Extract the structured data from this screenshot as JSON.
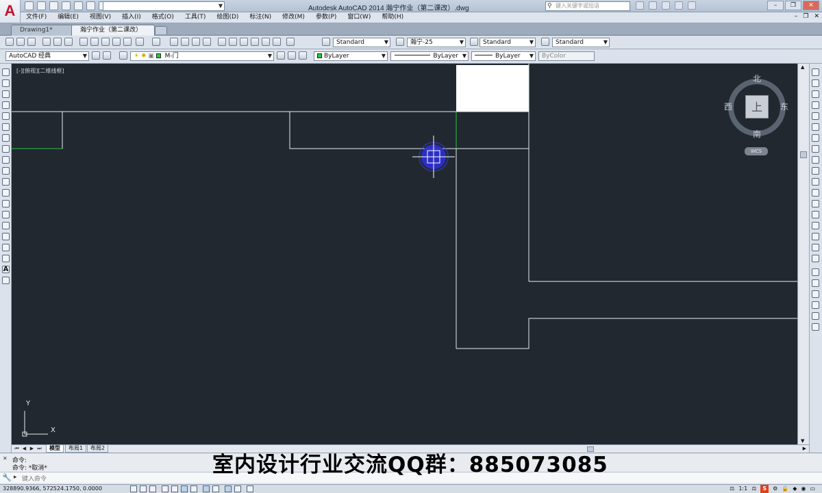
{
  "app": {
    "logo": "A",
    "title": "Autodesk AutoCAD 2014    瀚宁作业（第二课改）.dwg",
    "search_placeholder": "键入关键字或短语",
    "workspace_quick": ""
  },
  "menu": [
    "文件(F)",
    "编辑(E)",
    "视图(V)",
    "插入(I)",
    "格式(O)",
    "工具(T)",
    "绘图(D)",
    "标注(N)",
    "修改(M)",
    "参数(P)",
    "窗口(W)",
    "帮助(H)"
  ],
  "tabs": {
    "drawing1": "Drawing1*",
    "current": "瀚宁作业（第二课改）*"
  },
  "toolbar1": {
    "text_style": "Standard",
    "dim_style": "瀚宁-25",
    "table_style": "Standard",
    "mleader_style": "Standard"
  },
  "toolbar2": {
    "workspace": "AutoCAD 经典",
    "layer": "M-门",
    "color": "ByLayer",
    "linetype": "ByLayer",
    "lineweight": "ByLayer",
    "plotstyle": "ByColor"
  },
  "viewport": {
    "label": "[-][俯视][二维线框]"
  },
  "viewcube": {
    "north": "北",
    "south": "南",
    "east": "东",
    "west": "西",
    "top": "上",
    "wcs": "WCS"
  },
  "ucs": {
    "x": "X",
    "y": "Y"
  },
  "layout_tabs": [
    "模型",
    "布局1",
    "布局2"
  ],
  "command": {
    "line1": "命令:",
    "line2": "命令: *取消*",
    "input_placeholder": "键入命令"
  },
  "status": {
    "coords": "328890.9366, 572524.1750, 0.0000",
    "scale": "1:1",
    "app_s": "S"
  },
  "overlay": {
    "banner": "室内设计行业交流QQ群：885073085"
  },
  "colors": {
    "canvas": "#212830",
    "line_white": "#e8edf2",
    "line_green": "#27c93f",
    "cursor_blue": "#2c2fd6"
  }
}
